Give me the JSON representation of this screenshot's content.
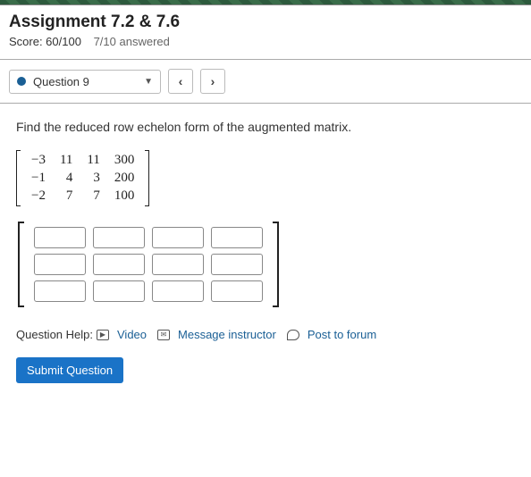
{
  "header": {
    "title": "Assignment 7.2 & 7.6",
    "score_label": "Score: 60/100",
    "answered_label": "7/10 answered"
  },
  "nav": {
    "question_label": "Question 9",
    "prev": "‹",
    "next": "›"
  },
  "question": {
    "prompt": "Find the reduced row echelon form of the augmented matrix.",
    "matrix": [
      [
        "−3",
        "11",
        "11",
        "300"
      ],
      [
        "−1",
        "4",
        "3",
        "200"
      ],
      [
        "−2",
        "7",
        "7",
        "100"
      ]
    ],
    "answer_grid": {
      "rows": 3,
      "cols": 4
    }
  },
  "help": {
    "label": "Question Help:",
    "video": "Video",
    "message": "Message instructor",
    "forum": "Post to forum"
  },
  "submit": {
    "label": "Submit Question"
  }
}
